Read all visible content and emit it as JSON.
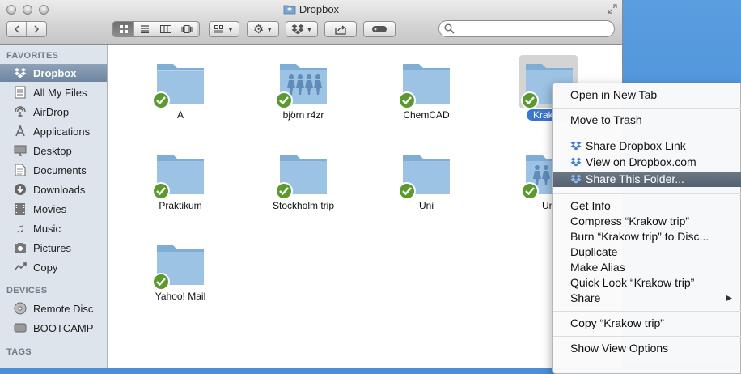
{
  "window": {
    "title": "Dropbox"
  },
  "toolbar": {
    "search_placeholder": ""
  },
  "sidebar": {
    "favorites_header": "FAVORITES",
    "favorites": [
      {
        "label": "Dropbox",
        "icon": "dropbox-icon",
        "selected": true
      },
      {
        "label": "All My Files",
        "icon": "all-files-icon"
      },
      {
        "label": "AirDrop",
        "icon": "airdrop-icon"
      },
      {
        "label": "Applications",
        "icon": "applications-icon"
      },
      {
        "label": "Desktop",
        "icon": "desktop-icon"
      },
      {
        "label": "Documents",
        "icon": "documents-icon"
      },
      {
        "label": "Downloads",
        "icon": "downloads-icon"
      },
      {
        "label": "Movies",
        "icon": "movies-icon"
      },
      {
        "label": "Music",
        "icon": "music-icon"
      },
      {
        "label": "Pictures",
        "icon": "pictures-icon"
      },
      {
        "label": "Copy",
        "icon": "copy-icon"
      }
    ],
    "devices_header": "DEVICES",
    "devices": [
      {
        "label": "Remote Disc",
        "icon": "disc-icon"
      },
      {
        "label": "BOOTCAMP",
        "icon": "drive-icon"
      }
    ],
    "tags_header": "TAGS"
  },
  "folders": [
    {
      "name": "A",
      "shared": false
    },
    {
      "name": "björn r4zr",
      "shared": true
    },
    {
      "name": "ChemCAD",
      "shared": false
    },
    {
      "name": "Krakow trip",
      "display": "Krakow",
      "shared": false,
      "selected": true
    },
    {
      "name": "Praktikum",
      "shared": false
    },
    {
      "name": "Stockholm trip",
      "shared": false
    },
    {
      "name": "Uni",
      "shared": false
    },
    {
      "name": "Uni",
      "display": "Uni",
      "shared": true
    },
    {
      "name": "Yahoo! Mail",
      "shared": false
    }
  ],
  "context_menu": {
    "items": [
      "Open in New Tab",
      "Move to Trash",
      "Share Dropbox Link",
      "View on Dropbox.com",
      "Share This Folder...",
      "Get Info",
      "Compress “Krakow trip”",
      "Burn “Krakow trip” to Disc...",
      "Duplicate",
      "Make Alias",
      "Quick Look “Krakow trip”",
      "Share",
      "Copy “Krakow trip”",
      "Show View Options"
    ],
    "highlighted": "Share This Folder..."
  },
  "colors": {
    "selection": "#3a76d0",
    "sync_badge": "#5a9a2e",
    "sidebar_bg": "#dde4eb",
    "desktop": "#4a8fd8"
  }
}
